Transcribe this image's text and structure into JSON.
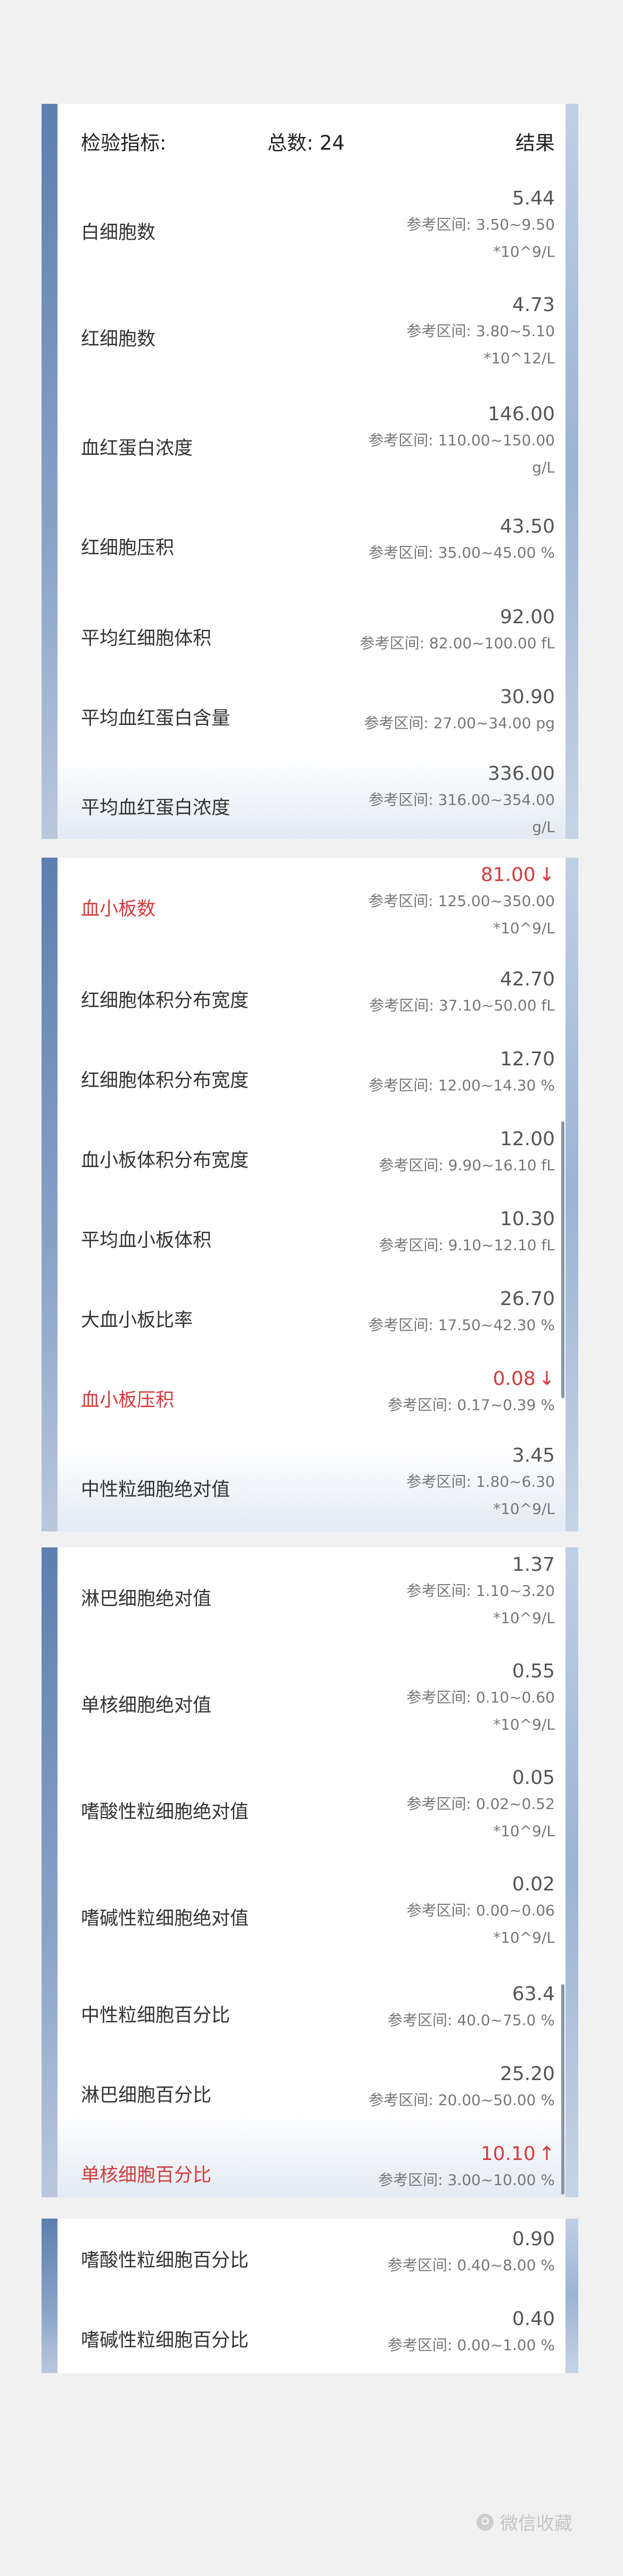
{
  "header": {
    "indicator_label": "检验指标:",
    "total_label": "总数: 24",
    "result_label": "结果"
  },
  "cards": [
    {
      "rows": [
        {
          "name": "白细胞数",
          "value": "5.44",
          "ref": "参考区间: 3.50~9.50",
          "unit": "*10^9/L",
          "abnormal": false,
          "arrow": ""
        },
        {
          "name": "红细胞数",
          "value": "4.73",
          "ref": "参考区间: 3.80~5.10",
          "unit": "*10^12/L",
          "abnormal": false,
          "arrow": ""
        },
        {
          "name": "血红蛋白浓度",
          "value": "146.00",
          "ref": "参考区间: 110.00~150.00",
          "unit": "g/L",
          "abnormal": false,
          "arrow": ""
        },
        {
          "name": "红细胞压积",
          "value": "43.50",
          "ref": "参考区间: 35.00~45.00 %",
          "unit": "",
          "abnormal": false,
          "arrow": ""
        },
        {
          "name": "平均红细胞体积",
          "value": "92.00",
          "ref": "参考区间: 82.00~100.00 fL",
          "unit": "",
          "abnormal": false,
          "arrow": ""
        },
        {
          "name": "平均血红蛋白含量",
          "value": "30.90",
          "ref": "参考区间: 27.00~34.00 pg",
          "unit": "",
          "abnormal": false,
          "arrow": ""
        },
        {
          "name": "平均血红蛋白浓度",
          "value": "336.00",
          "ref": "参考区间: 316.00~354.00",
          "unit": "g/L",
          "abnormal": false,
          "arrow": ""
        }
      ]
    },
    {
      "rows": [
        {
          "name": "血小板数",
          "value": "81.00",
          "ref": "参考区间: 125.00~350.00",
          "unit": "*10^9/L",
          "abnormal": true,
          "arrow": "↓"
        },
        {
          "name": "红细胞体积分布宽度",
          "value": "42.70",
          "ref": "参考区间: 37.10~50.00 fL",
          "unit": "",
          "abnormal": false,
          "arrow": ""
        },
        {
          "name": "红细胞体积分布宽度",
          "value": "12.70",
          "ref": "参考区间: 12.00~14.30 %",
          "unit": "",
          "abnormal": false,
          "arrow": ""
        },
        {
          "name": "血小板体积分布宽度",
          "value": "12.00",
          "ref": "参考区间: 9.90~16.10 fL",
          "unit": "",
          "abnormal": false,
          "arrow": ""
        },
        {
          "name": "平均血小板体积",
          "value": "10.30",
          "ref": "参考区间: 9.10~12.10 fL",
          "unit": "",
          "abnormal": false,
          "arrow": ""
        },
        {
          "name": "大血小板比率",
          "value": "26.70",
          "ref": "参考区间: 17.50~42.30 %",
          "unit": "",
          "abnormal": false,
          "arrow": ""
        },
        {
          "name": "血小板压积",
          "value": "0.08",
          "ref": "参考区间: 0.17~0.39 %",
          "unit": "",
          "abnormal": true,
          "arrow": "↓"
        },
        {
          "name": "中性粒细胞绝对值",
          "value": "3.45",
          "ref": "参考区间: 1.80~6.30",
          "unit": "*10^9/L",
          "abnormal": false,
          "arrow": ""
        }
      ]
    },
    {
      "rows": [
        {
          "name": "淋巴细胞绝对值",
          "value": "1.37",
          "ref": "参考区间: 1.10~3.20",
          "unit": "*10^9/L",
          "abnormal": false,
          "arrow": ""
        },
        {
          "name": "单核细胞绝对值",
          "value": "0.55",
          "ref": "参考区间: 0.10~0.60",
          "unit": "*10^9/L",
          "abnormal": false,
          "arrow": ""
        },
        {
          "name": "嗜酸性粒细胞绝对值",
          "value": "0.05",
          "ref": "参考区间: 0.02~0.52",
          "unit": "*10^9/L",
          "abnormal": false,
          "arrow": ""
        },
        {
          "name": "嗜碱性粒细胞绝对值",
          "value": "0.02",
          "ref": "参考区间: 0.00~0.06",
          "unit": "*10^9/L",
          "abnormal": false,
          "arrow": ""
        },
        {
          "name": "中性粒细胞百分比",
          "value": "63.4",
          "ref": "参考区间: 40.0~75.0 %",
          "unit": "",
          "abnormal": false,
          "arrow": ""
        },
        {
          "name": "淋巴细胞百分比",
          "value": "25.20",
          "ref": "参考区间: 20.00~50.00 %",
          "unit": "",
          "abnormal": false,
          "arrow": ""
        },
        {
          "name": "单核细胞百分比",
          "value": "10.10",
          "ref": "参考区间: 3.00~10.00 %",
          "unit": "",
          "abnormal": true,
          "arrow": "↑"
        }
      ]
    },
    {
      "rows": [
        {
          "name": "嗜酸性粒细胞百分比",
          "value": "0.90",
          "ref": "参考区间: 0.40~8.00 %",
          "unit": "",
          "abnormal": false,
          "arrow": ""
        },
        {
          "name": "嗜碱性粒细胞百分比",
          "value": "0.40",
          "ref": "参考区间: 0.00~1.00 %",
          "unit": "",
          "abnormal": false,
          "arrow": ""
        }
      ]
    }
  ],
  "watermark": "微信收藏",
  "colors": {
    "abnormal": "#d23c3c",
    "accent_bar": "#5d7fb0"
  }
}
